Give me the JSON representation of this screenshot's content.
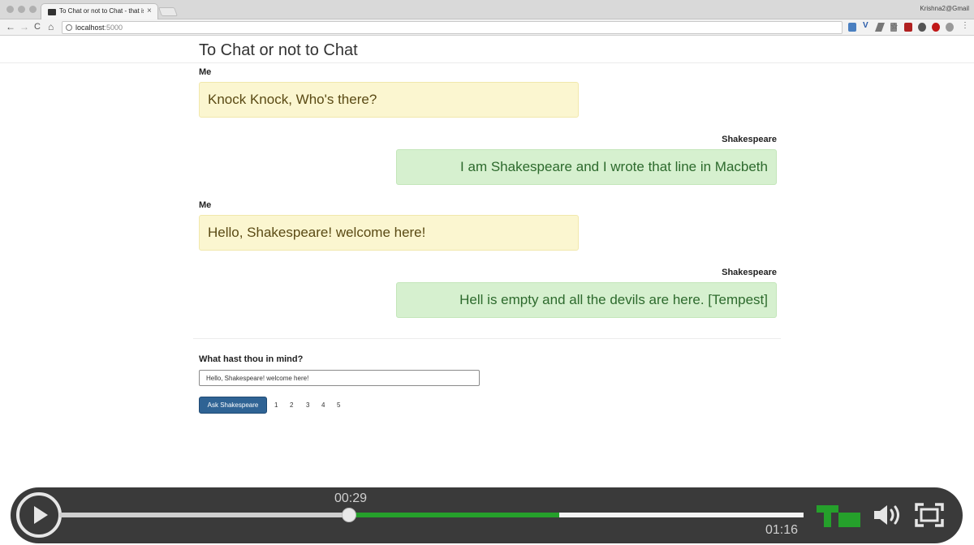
{
  "browser": {
    "tab_title": "To Chat or not to Chat - that is",
    "tab_close": "×",
    "profile": "Krishna2@Gmail",
    "url_host": "localhost",
    "url_port": ":5000",
    "nav": {
      "back": "←",
      "forward": "→",
      "reload": "C",
      "home": "⌂"
    },
    "extension_icons": [
      "calendar-icon",
      "v-icon",
      "pen-icon",
      "share-icon",
      "star-icon",
      "shield-icon",
      "stop-icon",
      "circle-icon",
      "play-icon",
      "camera-icon",
      "menu-icon"
    ]
  },
  "page": {
    "title": "To Chat or not to Chat",
    "messages": [
      {
        "sender": "Me",
        "text": "Knock Knock, Who's there?",
        "side": "left"
      },
      {
        "sender": "Shakespeare",
        "text": "I am Shakespeare and I wrote that line in Macbeth",
        "side": "right"
      },
      {
        "sender": "Me",
        "text": "Hello, Shakespeare! welcome here!",
        "side": "left"
      },
      {
        "sender": "Shakespeare",
        "text": "Hell is empty and all the devils are here. [Tempest]",
        "side": "right"
      }
    ],
    "prompt_label": "What hast thou in mind?",
    "prompt_value": "Hello, Shakespeare! welcome here!",
    "ask_button": "Ask Shakespeare",
    "pages": [
      "1",
      "2",
      "3",
      "4",
      "5"
    ]
  },
  "player": {
    "current_time": "00:29",
    "total_time": "01:16",
    "played_fraction": 0.389,
    "buffered_fraction": 0.672,
    "colors": {
      "buffered": "#25a02b",
      "logo": "#25a02b",
      "bar": "#3a3a3a"
    },
    "icons": [
      "play-icon",
      "techcrunch-logo",
      "volume-icon",
      "fullscreen-icon"
    ]
  }
}
